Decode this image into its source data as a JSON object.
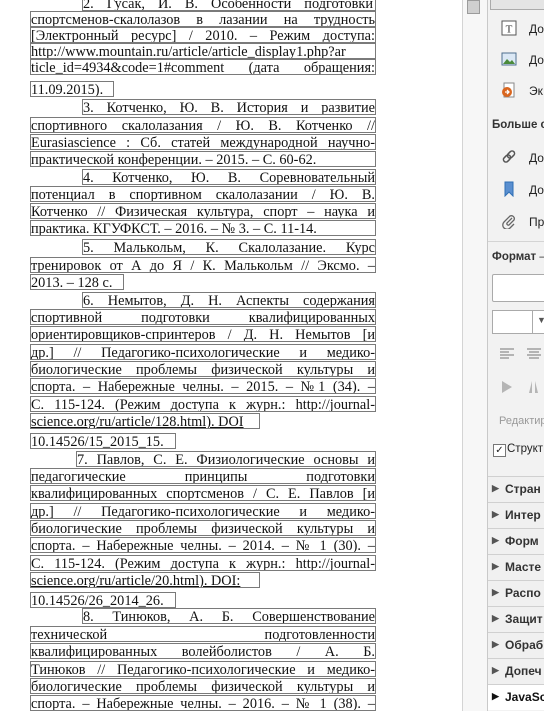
{
  "document": {
    "lines": [
      "2. Гусак, И. В. Особенности подготовки",
      "спортсменов-скалолазов в лазании на трудность",
      "[Электронный ресурс] / 2010. – Режим доступа:",
      "http://www.mountain.ru/article/article_display1.php?ar",
      "ticle_id=4934&code=1#comment (дата обращения:",
      "11.09.2015).",
      "3. Котченко, Ю. В. История и развитие",
      "спортивного скалолазания / Ю. В. Котченко //",
      "Eurasiascience : Сб. статей международной научно-",
      "практической конференции. – 2015. – С. 60-62.",
      "4. Котченко, Ю. В. Соревновательный",
      "потенциал в спортивном скалолазании / Ю. В.",
      "Котченко // Физическая культура, спорт – наука и",
      "практика. КГУФКСТ. – 2016. – № 3. – С. 11-14.",
      "5. Малькольм, К. Скалолазание. Курс",
      "тренировок от А до Я / К. Малькольм // Эксмо. –",
      "2013. – 128 с.",
      "6. Немытов, Д. Н. Аспекты содержания",
      "спортивной подготовки квалифицированных",
      "ориентировщиков-спринтеров / Д. Н. Немытов [и",
      "др.] // Педагогико-психологические и медико-",
      "биологические проблемы физической культуры и",
      "спорта. – Набережные челны. – 2015. – №1 (34). –",
      "С. 115-124. (Режим доступа к журн.: http://journal-",
      "science.org/ru/article/128.html). DOI",
      "10.14526/15_2015_15.",
      "7. Павлов, С. Е. Физиологические основы и",
      "педагогические принципы подготовки",
      "квалифицированных спортсменов / С. Е. Павлов [и",
      "др.] // Педагогико-психологические и медико-",
      "биологические проблемы физической культуры и",
      "спорта. – Набережные челны. – 2014. – № 1 (30). –",
      "С. 115-124. (Режим доступа к журн.: http://journal-",
      "science.org/ru/article/20.html). DOI:",
      "10.14526/26_2014_26.",
      "8. Тинюков, А. Б. Совершенствование",
      "технической подготовленности",
      "квалифицированных волейболистов / А. Б.",
      "Тинюков // Педагогико-психологические и медико-",
      "биологические проблемы физической культуры и",
      "спорта. – Набережные челны. – 2016. – № 1 (38). –"
    ]
  },
  "panel": {
    "items_top": [
      {
        "label": "До",
        "icon": "text-box-icon"
      },
      {
        "label": "До",
        "icon": "image-icon"
      },
      {
        "label": "Эк",
        "icon": "export-icon"
      }
    ],
    "more_heading": "Больше с",
    "items_more": [
      {
        "label": "До",
        "icon": "link-icon"
      },
      {
        "label": "До",
        "icon": "bookmark-icon"
      },
      {
        "label": "Пр",
        "icon": "paperclip-icon"
      }
    ],
    "format_heading": "Формат",
    "edit_label": "Редактир",
    "checkbox_label": "Структ",
    "accordions": [
      "Стран",
      "Интер",
      "Форм",
      "Масте",
      "Распо",
      "Защит",
      "Обраб",
      "Допеч",
      "JavaSc"
    ]
  },
  "colors": {
    "border": "#7a7a7a",
    "panel_bg": "#f2f2f2",
    "icon_blue": "#2f6fb5",
    "icon_orange": "#d9661f"
  }
}
